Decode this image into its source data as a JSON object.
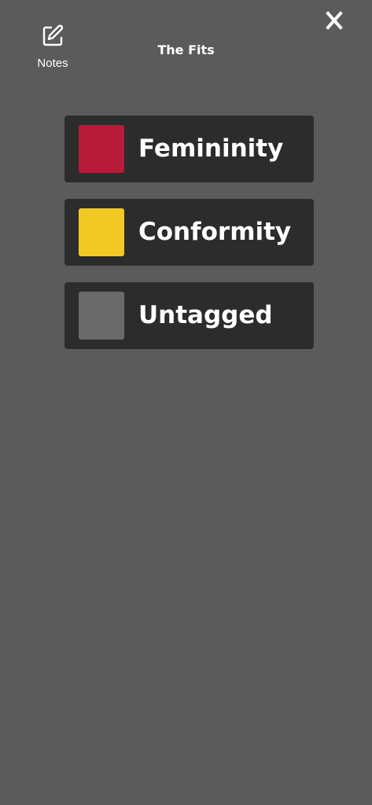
{
  "header": {
    "notes_label": "Notes",
    "notes_icon": "edit-note-icon",
    "title": "The Fits",
    "close_icon": "close-x-icon"
  },
  "tags": [
    {
      "label": "Femininity",
      "color": "#b71c3a"
    },
    {
      "label": "Conformity",
      "color": "#f2c823"
    },
    {
      "label": "Untagged",
      "color": "#6a6a6a"
    }
  ]
}
